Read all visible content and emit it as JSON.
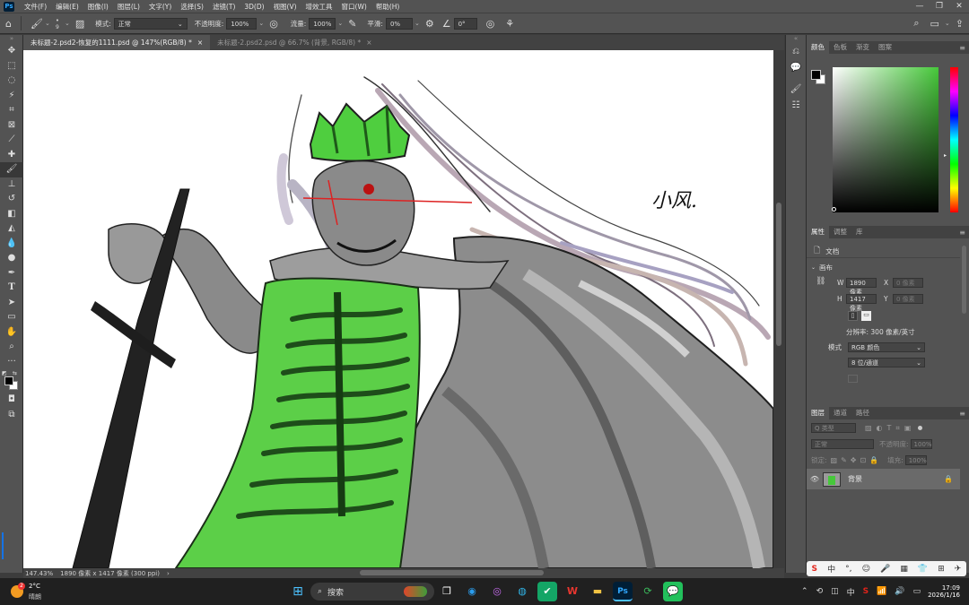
{
  "menubar": {
    "logo": "Ps",
    "items": [
      "文件(F)",
      "编辑(E)",
      "图像(I)",
      "图层(L)",
      "文字(Y)",
      "选择(S)",
      "滤镜(T)",
      "3D(D)",
      "视图(V)",
      "增效工具",
      "窗口(W)",
      "帮助(H)"
    ],
    "window_controls": [
      "—",
      "❐",
      "✕"
    ]
  },
  "options": {
    "brush_size": "9",
    "mode_label": "模式:",
    "mode_value": "正常",
    "opacity_label": "不透明度:",
    "opacity_value": "100%",
    "flow_label": "流量:",
    "flow_value": "100%",
    "smoothing_label": "平滑:",
    "smoothing_value": "0%",
    "angle_value": "0°"
  },
  "tabs": [
    {
      "label": "未标题-2.psd2-恢复的1111.psd @ 147%(RGB/8) *",
      "close": "×"
    },
    {
      "label": "未标题-2.psd2.psd @ 66.7% (背景, RGB/8) *",
      "close": "×"
    }
  ],
  "status": {
    "zoom": "147.43%",
    "doc_info": "1890 像素 x 1417 像素 (300 ppi)",
    "arrow": "›"
  },
  "color_panel": {
    "tabs": [
      "颜色",
      "色板",
      "渐变",
      "图案"
    ],
    "menu": "≡"
  },
  "properties_panel": {
    "tabs": [
      "属性",
      "调整",
      "库"
    ],
    "doc_label": "文档",
    "section": "画布",
    "w_label": "W",
    "w_value": "1890 像素",
    "x_label": "X",
    "x_placeholder": "0 像素",
    "h_label": "H",
    "h_value": "1417 像素",
    "y_label": "Y",
    "y_placeholder": "0 像素",
    "resolution": "分辨率: 300 像素/英寸",
    "mode_label": "模式",
    "mode_value": "RGB 颜色",
    "depth_value": "8 位/通道"
  },
  "layers_panel": {
    "tabs": [
      "图层",
      "通道",
      "路径"
    ],
    "filter_label": "Q 类型",
    "blend_value": "正常",
    "opacity_label": "不透明度:",
    "opacity_value": "100%",
    "lock_label": "锁定:",
    "fill_label": "填充:",
    "fill_value": "100%",
    "layers": [
      {
        "name": "背景",
        "visible": true,
        "locked": true
      }
    ]
  },
  "canvas": {
    "signature": "小风."
  },
  "ime_bar": {
    "items": [
      "S",
      "中",
      "°,",
      "☺",
      "🎤",
      "▦",
      "👕",
      "⊞",
      "✈"
    ]
  },
  "taskbar": {
    "weather_temp": "2°C",
    "weather_desc": "晴朗",
    "weather_badge": "2",
    "search_placeholder": "搜索",
    "tray_lang": "中",
    "time": "17:09",
    "date": "2026/1/16"
  },
  "colors": {
    "ui_dark": "#535353",
    "ui_darker": "#424242",
    "skeleton_green": "#46c83a",
    "taskbar": "#202020"
  }
}
